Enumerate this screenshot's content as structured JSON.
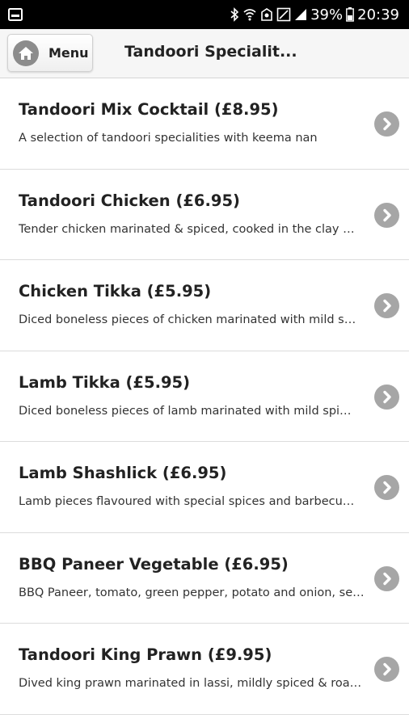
{
  "status_bar": {
    "battery_percent": "39%",
    "time": "20:39",
    "icons": [
      "notification-icon",
      "bluetooth-icon",
      "wifi-icon",
      "alarm-icon",
      "no-sim-icon",
      "signal-icon",
      "battery-icon"
    ]
  },
  "header": {
    "menu_label": "Menu",
    "title": "Tandoori Specialit..."
  },
  "items": [
    {
      "title": "Tandoori Mix Cocktail (£8.95)",
      "description": "A selection of tandoori specialities with keema nan"
    },
    {
      "title": "Tandoori Chicken (£6.95)",
      "description": "Tender chicken marinated & spiced, cooked in the clay …"
    },
    {
      "title": "Chicken Tikka (£5.95)",
      "description": "Diced boneless pieces of chicken marinated with mild s…"
    },
    {
      "title": "Lamb Tikka (£5.95)",
      "description": "Diced boneless pieces of lamb marinated with mild spi…"
    },
    {
      "title": "Lamb Shashlick (£6.95)",
      "description": "Lamb pieces flavoured with special spices and barbecu…"
    },
    {
      "title": "BBQ Paneer Vegetable (£6.95)",
      "description": "BBQ Paneer, tomato, green pepper, potato and onion, se…"
    },
    {
      "title": "Tandoori King Prawn (£9.95)",
      "description": "Dived king prawn marinated in lassi, mildly spiced & roa…"
    }
  ],
  "colors": {
    "status_bar_bg": "#000000",
    "header_bg": "#f6f6f6",
    "chevron_bg": "#a6a6a6",
    "divider": "#dcdcdc"
  }
}
